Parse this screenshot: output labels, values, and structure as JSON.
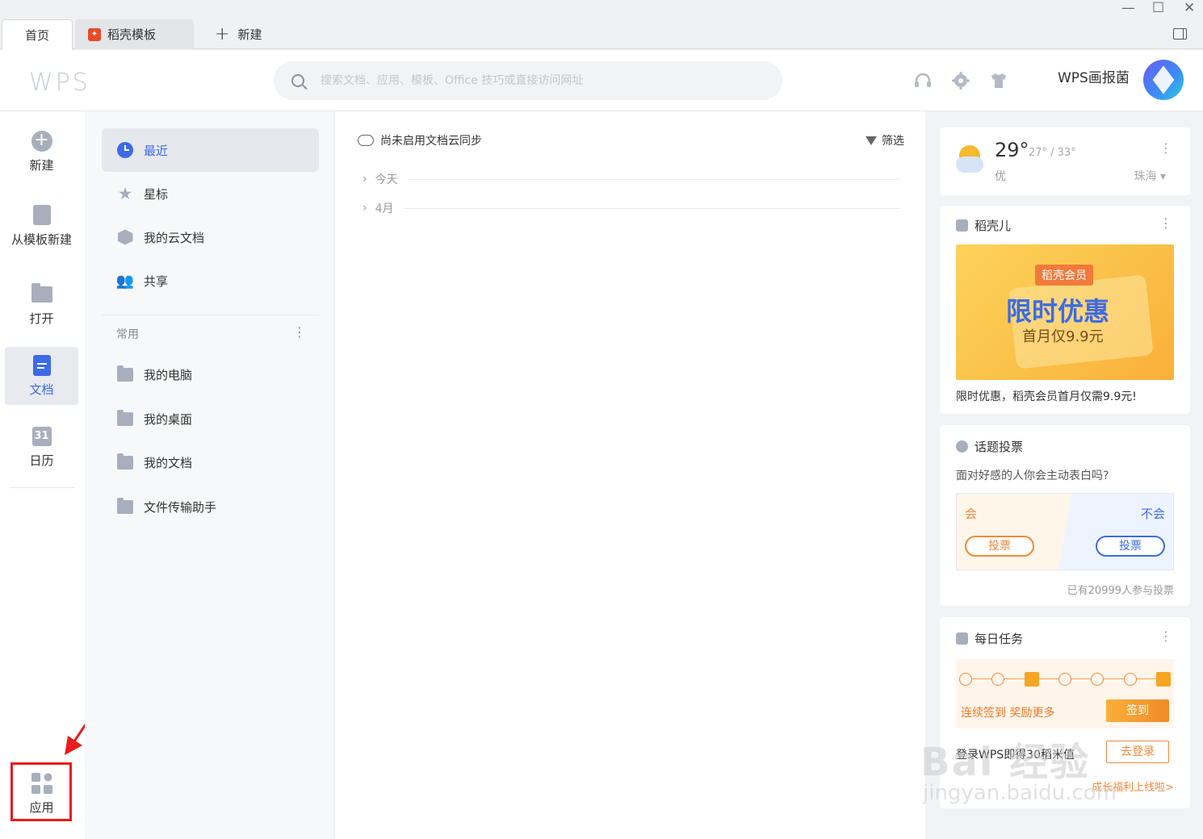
{
  "tabs": [
    {
      "label": "首页"
    },
    {
      "label": "稻壳模板"
    },
    {
      "label": "新建"
    }
  ],
  "window_controls": {
    "minimize": "—",
    "maximize": "☐",
    "close": "✕"
  },
  "header": {
    "logo": "WPS",
    "search_placeholder": "搜索文档、应用、模板、Office 技巧或直接访问网址",
    "user_name": "WPS画报菌"
  },
  "rail": {
    "items": [
      {
        "label": "新建"
      },
      {
        "label": "从模板新建"
      },
      {
        "label": "打开"
      },
      {
        "label": "文档"
      },
      {
        "label": "日历",
        "icon_text": "31"
      },
      {
        "label": "应用"
      }
    ]
  },
  "nav": {
    "items": [
      {
        "label": "最近"
      },
      {
        "label": "星标"
      },
      {
        "label": "我的云文档"
      },
      {
        "label": "共享"
      }
    ],
    "section_label": "常用",
    "common": [
      {
        "label": "我的电脑"
      },
      {
        "label": "我的桌面"
      },
      {
        "label": "我的文档"
      },
      {
        "label": "文件传输助手"
      }
    ]
  },
  "main": {
    "sync_text": "尚未启用文档云同步",
    "filter_label": "筛选",
    "groups": [
      {
        "label": "今天"
      },
      {
        "label": "4月"
      }
    ]
  },
  "weather": {
    "temp": "29°",
    "range": "27° / 33°",
    "air_quality": "优",
    "city": "珠海"
  },
  "docer": {
    "title": "稻壳儿",
    "badge": "稻壳会员",
    "headline": "限时优惠",
    "subline": "首月仅9.9元",
    "caption": "限时优惠，稻壳会员首月仅需9.9元!"
  },
  "poll": {
    "title": "话题投票",
    "question": "面对好感的人你会主动表白吗?",
    "option_yes": "会",
    "option_no": "不会",
    "vote_label": "投票",
    "count_text": "已有20999人参与投票"
  },
  "tasks": {
    "title": "每日任务",
    "streak_text": "连续签到 奖励更多",
    "signin_label": "签到",
    "login_text": "登录WPS即得30稻米值",
    "login_label": "去登录",
    "growth_link": "成长福利上线啦>"
  },
  "watermark": {
    "line1": "Bai 经验",
    "line2": "jingyan.baidu.com"
  },
  "colors": {
    "accent": "#3d6be6",
    "orange": "#ef8a3a",
    "highlight_red": "#e81c1c"
  }
}
